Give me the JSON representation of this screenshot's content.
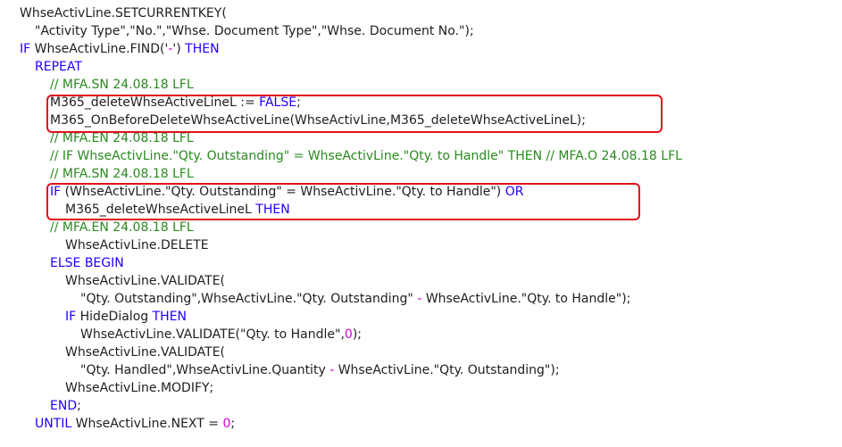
{
  "code_lines": [
    {
      "indent": 0,
      "tokens": [
        {
          "t": "WhseActivLine.SETCURRENTKEY(",
          "c": ""
        }
      ]
    },
    {
      "indent": 1,
      "tokens": [
        {
          "t": "\"Activity Type\",\"No.\",\"Whse. Document Type\",\"Whse. Document No.\");",
          "c": ""
        }
      ]
    },
    {
      "indent": 0,
      "tokens": [
        {
          "t": "IF",
          "c": "kw"
        },
        {
          "t": " WhseActivLine.FIND('",
          "c": ""
        },
        {
          "t": "-",
          "c": "op"
        },
        {
          "t": "') ",
          "c": ""
        },
        {
          "t": "THEN",
          "c": "kw"
        }
      ]
    },
    {
      "indent": 1,
      "tokens": [
        {
          "t": "REPEAT",
          "c": "kw"
        }
      ]
    },
    {
      "indent": 2,
      "tokens": [
        {
          "t": "// MFA.SN 24.08.18 LFL",
          "c": "cm"
        }
      ]
    },
    {
      "indent": 2,
      "tokens": [
        {
          "t": "M365_deleteWhseActiveLineL := ",
          "c": ""
        },
        {
          "t": "FALSE",
          "c": "kw"
        },
        {
          "t": ";",
          "c": ""
        }
      ]
    },
    {
      "indent": 2,
      "tokens": [
        {
          "t": "M365_OnBeforeDeleteWhseActiveLine(WhseActivLine,M365_deleteWhseActiveLineL);",
          "c": ""
        }
      ]
    },
    {
      "indent": 2,
      "tokens": [
        {
          "t": "// MFA.EN 24.08.18 LFL",
          "c": "cm"
        }
      ]
    },
    {
      "indent": 2,
      "tokens": [
        {
          "t": "// IF WhseActivLine.\"Qty. Outstanding\" = WhseActivLine.\"Qty. to Handle\" THEN // MFA.O 24.08.18 LFL",
          "c": "cm"
        }
      ]
    },
    {
      "indent": 2,
      "tokens": [
        {
          "t": "// MFA.SN 24.08.18 LFL",
          "c": "cm"
        }
      ]
    },
    {
      "indent": 2,
      "tokens": [
        {
          "t": "IF",
          "c": "kw"
        },
        {
          "t": " (WhseActivLine.\"Qty. Outstanding\" = WhseActivLine.\"Qty. to Handle\") ",
          "c": ""
        },
        {
          "t": "OR",
          "c": "kw"
        }
      ]
    },
    {
      "indent": 3,
      "tokens": [
        {
          "t": "M365_deleteWhseActiveLineL ",
          "c": ""
        },
        {
          "t": "THEN",
          "c": "kw"
        }
      ]
    },
    {
      "indent": 2,
      "tokens": [
        {
          "t": "// MFA.EN 24.08.18 LFL",
          "c": "cm"
        }
      ]
    },
    {
      "indent": 3,
      "tokens": [
        {
          "t": "WhseActivLine.DELETE",
          "c": ""
        }
      ]
    },
    {
      "indent": 2,
      "tokens": [
        {
          "t": "ELSE BEGIN",
          "c": "kw"
        }
      ]
    },
    {
      "indent": 3,
      "tokens": [
        {
          "t": "WhseActivLine.VALIDATE(",
          "c": ""
        }
      ]
    },
    {
      "indent": 4,
      "tokens": [
        {
          "t": "\"Qty. Outstanding\",WhseActivLine.\"Qty. Outstanding\" ",
          "c": ""
        },
        {
          "t": "-",
          "c": "op"
        },
        {
          "t": " WhseActivLine.\"Qty. to Handle\");",
          "c": ""
        }
      ]
    },
    {
      "indent": 3,
      "tokens": [
        {
          "t": "IF",
          "c": "kw"
        },
        {
          "t": " HideDialog ",
          "c": ""
        },
        {
          "t": "THEN",
          "c": "kw"
        }
      ]
    },
    {
      "indent": 4,
      "tokens": [
        {
          "t": "WhseActivLine.VALIDATE(\"Qty. to Handle\",",
          "c": ""
        },
        {
          "t": "0",
          "c": "num"
        },
        {
          "t": ");",
          "c": ""
        }
      ]
    },
    {
      "indent": 3,
      "tokens": [
        {
          "t": "WhseActivLine.VALIDATE(",
          "c": ""
        }
      ]
    },
    {
      "indent": 4,
      "tokens": [
        {
          "t": "\"Qty. Handled\",WhseActivLine.Quantity ",
          "c": ""
        },
        {
          "t": "-",
          "c": "op"
        },
        {
          "t": " WhseActivLine.\"Qty. Outstanding\");",
          "c": ""
        }
      ]
    },
    {
      "indent": 3,
      "tokens": [
        {
          "t": "WhseActivLine.MODIFY;",
          "c": ""
        }
      ]
    },
    {
      "indent": 2,
      "tokens": [
        {
          "t": "END",
          "c": "kw"
        },
        {
          "t": ";",
          "c": ""
        }
      ]
    },
    {
      "indent": 1,
      "tokens": [
        {
          "t": "UNTIL",
          "c": "kw"
        },
        {
          "t": " WhseActivLine.NEXT = ",
          "c": ""
        },
        {
          "t": "0",
          "c": "num"
        },
        {
          "t": ";",
          "c": ""
        }
      ]
    }
  ],
  "colors": {
    "keyword": "#1f00ff",
    "comment": "#2a8a1f",
    "number": "#d400d4",
    "highlight_border": "#e0101a"
  }
}
